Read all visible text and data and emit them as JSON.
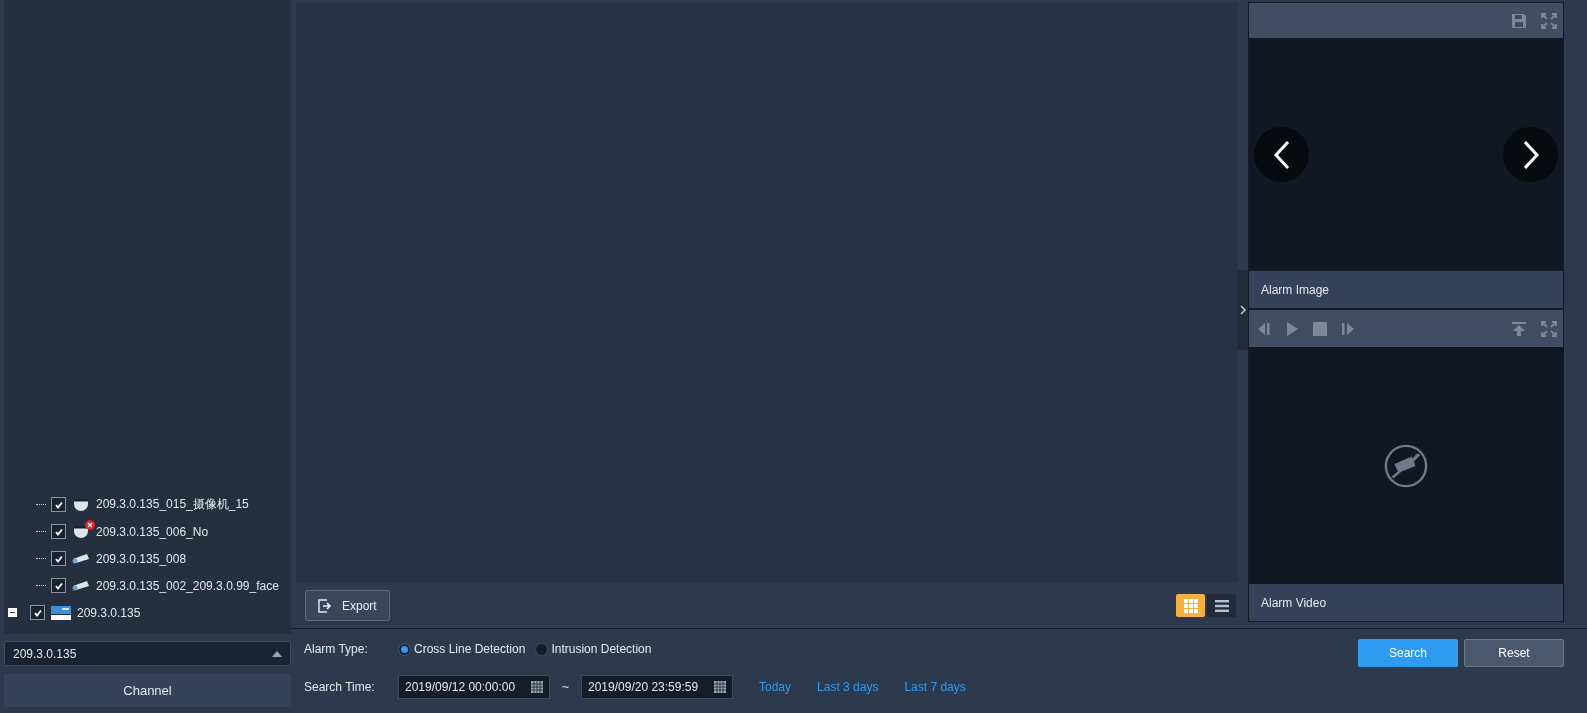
{
  "device_tree": {
    "root": {
      "label": "209.3.0.135",
      "expanded": true,
      "checked": true,
      "children": [
        {
          "label": "209.3.0.135_015_摄像机_15",
          "kind": "dome",
          "checked": true,
          "offline": false
        },
        {
          "label": "209.3.0.135_006_No",
          "kind": "dome",
          "checked": true,
          "offline": true
        },
        {
          "label": "209.3.0.135_008",
          "kind": "bullet",
          "checked": true,
          "offline": false
        },
        {
          "label": "209.3.0.135_002_209.3.0.99_face",
          "kind": "bullet",
          "checked": true,
          "offline": false
        }
      ]
    }
  },
  "channel_select": {
    "value": "209.3.0.135"
  },
  "channel_tab": {
    "label": "Channel"
  },
  "export_button": {
    "label": "Export"
  },
  "view_modes": [
    {
      "kind": "grid",
      "selected": true
    },
    {
      "kind": "list",
      "selected": false
    }
  ],
  "alarm_image": {
    "label": "Alarm Image"
  },
  "alarm_video": {
    "label": "Alarm Video"
  },
  "alarm_type": {
    "label": "Alarm Type:",
    "options": [
      {
        "label": "Cross Line Detection",
        "selected": true
      },
      {
        "label": "Intrusion Detection",
        "selected": false
      }
    ]
  },
  "search_time": {
    "label": "Search Time:",
    "start": "2019/09/12 00:00:00",
    "separator": "~",
    "end": "2019/09/20 23:59:59"
  },
  "quick_ranges": [
    "Today",
    "Last 3 days",
    "Last 7 days"
  ],
  "buttons": {
    "search": "Search",
    "reset": "Reset"
  }
}
